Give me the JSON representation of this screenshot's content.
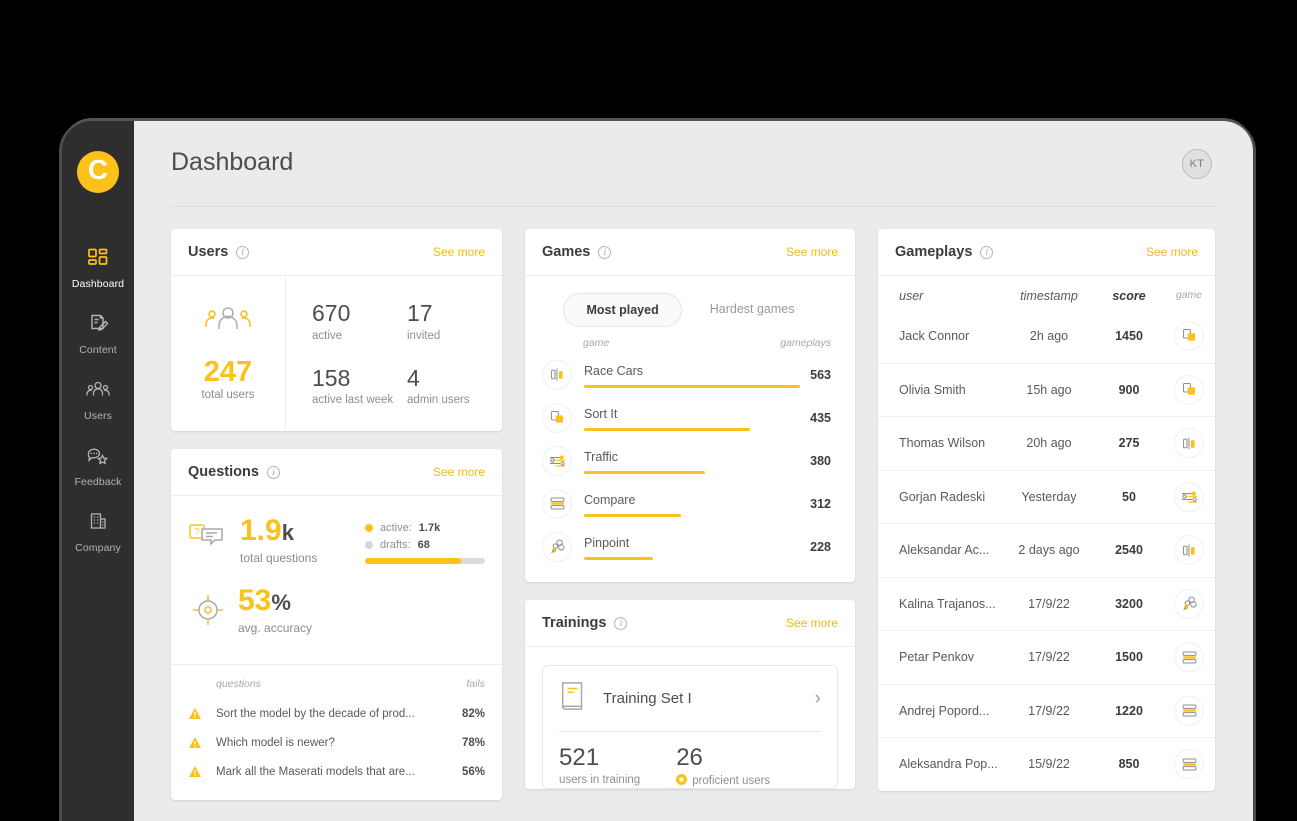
{
  "header": {
    "title": "Dashboard",
    "avatar_initials": "KT"
  },
  "sidebar": {
    "logo_letter": "C",
    "items": [
      {
        "label": "Dashboard",
        "icon": "grid-icon",
        "active": true
      },
      {
        "label": "Content",
        "icon": "content-edit-icon",
        "active": false
      },
      {
        "label": "Users",
        "icon": "users-icon",
        "active": false
      },
      {
        "label": "Feedback",
        "icon": "feedback-star-icon",
        "active": false
      },
      {
        "label": "Company",
        "icon": "company-building-icon",
        "active": false
      }
    ]
  },
  "users_card": {
    "title": "Users",
    "see_more": "See more",
    "total": "247",
    "total_label": "total users",
    "stats": [
      {
        "value": "670",
        "label": "active"
      },
      {
        "value": "17",
        "label": "invited"
      },
      {
        "value": "158",
        "label": "active last week"
      },
      {
        "value": "4",
        "label": "admin users"
      }
    ]
  },
  "questions_card": {
    "title": "Questions",
    "see_more": "See more",
    "total": "1.9",
    "total_unit": "k",
    "total_label": "total questions",
    "accuracy": "53",
    "accuracy_unit": "%",
    "accuracy_label": "avg. accuracy",
    "legend": {
      "active_label": "active:",
      "active_value": "1.7k",
      "drafts_label": "drafts:",
      "drafts_value": "68",
      "bar_percent": 80
    },
    "table": {
      "col_question": "questions",
      "col_fails": "fails",
      "rows": [
        {
          "question": "Sort the model by the decade of prod...",
          "fails": "82%"
        },
        {
          "question": "Which model is newer?",
          "fails": "78%"
        },
        {
          "question": "Mark all the Maserati models that are...",
          "fails": "56%"
        }
      ]
    }
  },
  "games_card": {
    "title": "Games",
    "see_more": "See more",
    "tabs": [
      {
        "label": "Most played",
        "active": true
      },
      {
        "label": "Hardest games",
        "active": false
      }
    ],
    "col_game": "game",
    "col_gameplays": "gameplays",
    "rows": [
      {
        "name": "Race Cars",
        "gameplays": "563",
        "bar_percent": 100,
        "icon": "race-cars-icon"
      },
      {
        "name": "Sort It",
        "gameplays": "435",
        "bar_percent": 77,
        "icon": "sort-it-icon"
      },
      {
        "name": "Traffic",
        "gameplays": "380",
        "bar_percent": 56,
        "icon": "traffic-icon"
      },
      {
        "name": "Compare",
        "gameplays": "312",
        "bar_percent": 45,
        "icon": "compare-icon"
      },
      {
        "name": "Pinpoint",
        "gameplays": "228",
        "bar_percent": 32,
        "icon": "pinpoint-icon"
      }
    ]
  },
  "trainings_card": {
    "title": "Trainings",
    "see_more": "See more",
    "set_name": "Training Set I",
    "users_in_training": "521",
    "users_in_training_label": "users in training",
    "proficient_users": "26",
    "proficient_users_label": "proficient users"
  },
  "gameplays_card": {
    "title": "Gameplays",
    "see_more": "See more",
    "col_user": "user",
    "col_timestamp": "timestamp",
    "col_score": "score",
    "col_game": "game",
    "rows": [
      {
        "user": "Jack Connor",
        "timestamp": "2h ago",
        "score": "1450",
        "icon": "sort-it-icon"
      },
      {
        "user": "Olivia Smith",
        "timestamp": "15h ago",
        "score": "900",
        "icon": "sort-it-icon"
      },
      {
        "user": "Thomas Wilson",
        "timestamp": "20h ago",
        "score": "275",
        "icon": "race-cars-icon"
      },
      {
        "user": "Gorjan Radeski",
        "timestamp": "Yesterday",
        "score": "50",
        "icon": "traffic-icon"
      },
      {
        "user": "Aleksandar Ac...",
        "timestamp": "2 days ago",
        "score": "2540",
        "icon": "race-cars-icon"
      },
      {
        "user": "Kalina Trajanos...",
        "timestamp": "17/9/22",
        "score": "3200",
        "icon": "pinpoint-icon"
      },
      {
        "user": "Petar Penkov",
        "timestamp": "17/9/22",
        "score": "1500",
        "icon": "compare-icon"
      },
      {
        "user": "Andrej Popord...",
        "timestamp": "17/9/22",
        "score": "1220",
        "icon": "compare-icon"
      },
      {
        "user": "Aleksandra Pop...",
        "timestamp": "15/9/22",
        "score": "850",
        "icon": "compare-icon"
      }
    ]
  },
  "colors": {
    "accent": "#fcc21b",
    "sidebar_bg": "#2e2e2e",
    "page_bg": "#ebebeb",
    "card_bg": "#ffffff",
    "text_primary": "#4d4d4d",
    "text_muted": "#8f8f8f"
  }
}
